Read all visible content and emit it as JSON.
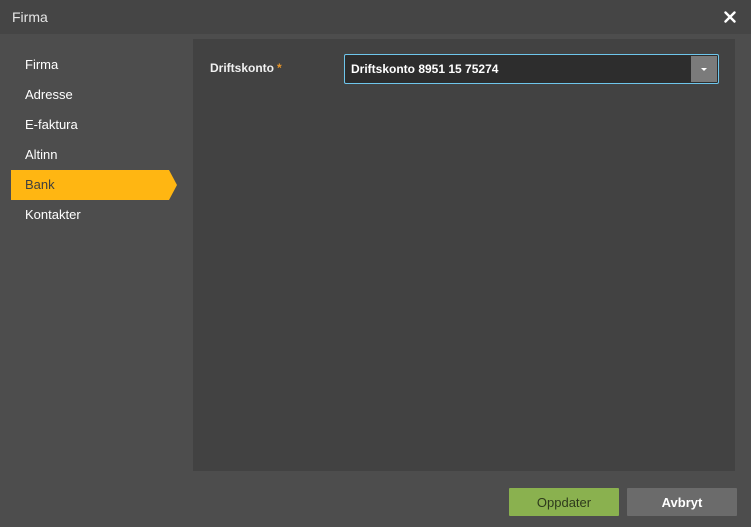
{
  "window": {
    "title": "Firma",
    "close_icon": "close-icon"
  },
  "sidebar": {
    "items": [
      {
        "label": "Firma",
        "active": false
      },
      {
        "label": "Adresse",
        "active": false
      },
      {
        "label": "E-faktura",
        "active": false
      },
      {
        "label": "Altinn",
        "active": false
      },
      {
        "label": "Bank",
        "active": true
      },
      {
        "label": "Kontakter",
        "active": false
      }
    ]
  },
  "form": {
    "driftskonto": {
      "label": "Driftskonto",
      "required_marker": "*",
      "value": "Driftskonto 8951 15 75274",
      "icon": "chevron-down-icon"
    }
  },
  "footer": {
    "update_label": "Oppdater",
    "cancel_label": "Avbryt"
  },
  "colors": {
    "accent": "#ffb612",
    "update_button": "#8ab14f",
    "focus_border": "#6ec6ec",
    "required": "#e8962a"
  }
}
